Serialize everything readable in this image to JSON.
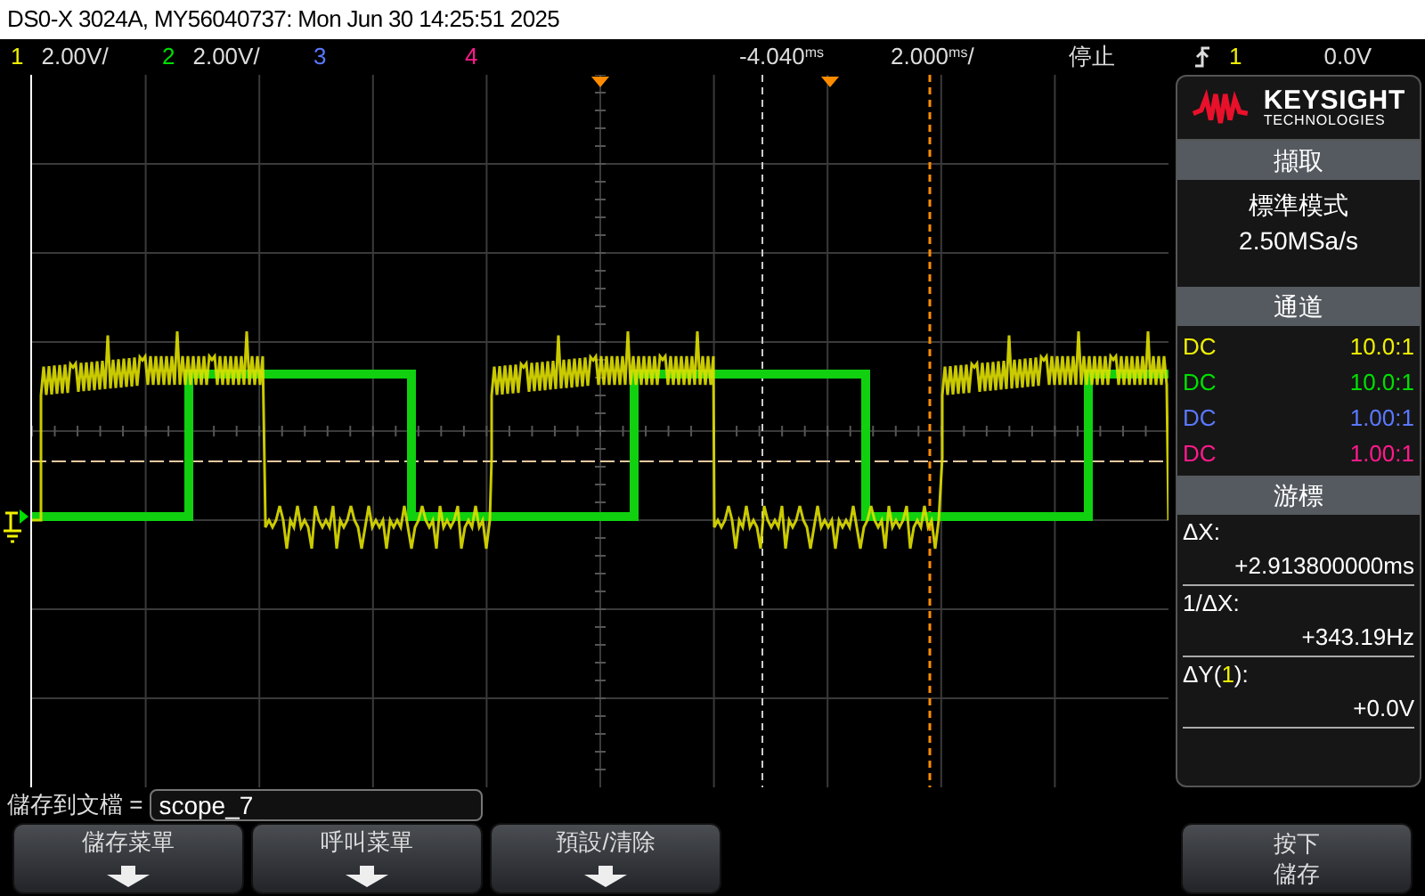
{
  "window": {
    "title": "DS0-X 3024A, MY56040737: Mon Jun 30 14:25:51 2025"
  },
  "status_bar": {
    "channels": [
      {
        "number": "1",
        "scale": "2.00V/",
        "color": "#f0f000"
      },
      {
        "number": "2",
        "scale": "2.00V/",
        "color": "#00e000"
      },
      {
        "number": "3",
        "color": "#5a78ff"
      },
      {
        "number": "4",
        "color": "#ff1a8c"
      }
    ],
    "delay": "-4.040$^{ms}$",
    "timebase": "2.000$^{ms}$/",
    "run_state": "停止",
    "trigger_source": "1",
    "trigger_level": "0.0V"
  },
  "panel": {
    "logo": {
      "name": "KEYSIGHT",
      "subtitle": "TECHNOLOGIES"
    },
    "acquisition": {
      "title": "擷取",
      "mode": "標準模式",
      "rate": "2.50MSa/s"
    },
    "channels": {
      "title": "通道",
      "rows": [
        {
          "coupling": "DC",
          "probe": "10.0:1",
          "color": "#f0f000"
        },
        {
          "coupling": "DC",
          "probe": "10.0:1",
          "color": "#00e000"
        },
        {
          "coupling": "DC",
          "probe": "1.00:1",
          "color": "#5a78ff"
        },
        {
          "coupling": "DC",
          "probe": "1.00:1",
          "color": "#ff1a8c"
        }
      ]
    },
    "cursors": {
      "title": "游標",
      "rows": [
        {
          "label": "ΔX:",
          "value": "+2.913800000ms"
        },
        {
          "label": "1/ΔX:",
          "value": "+343.19Hz"
        },
        {
          "label": "ΔY(",
          "channel": "1",
          "label_end": "):",
          "value": "+0.0V"
        }
      ]
    }
  },
  "file_field": {
    "label": "儲存到文檔 =",
    "value": "scope_7"
  },
  "softkeys": [
    {
      "label": "儲存菜單",
      "arrow": true
    },
    {
      "label": "呼叫菜單",
      "arrow": true
    },
    {
      "label": "預設/清除",
      "arrow": true
    }
  ],
  "save_key": {
    "lines": [
      "按下",
      "儲存"
    ]
  }
}
